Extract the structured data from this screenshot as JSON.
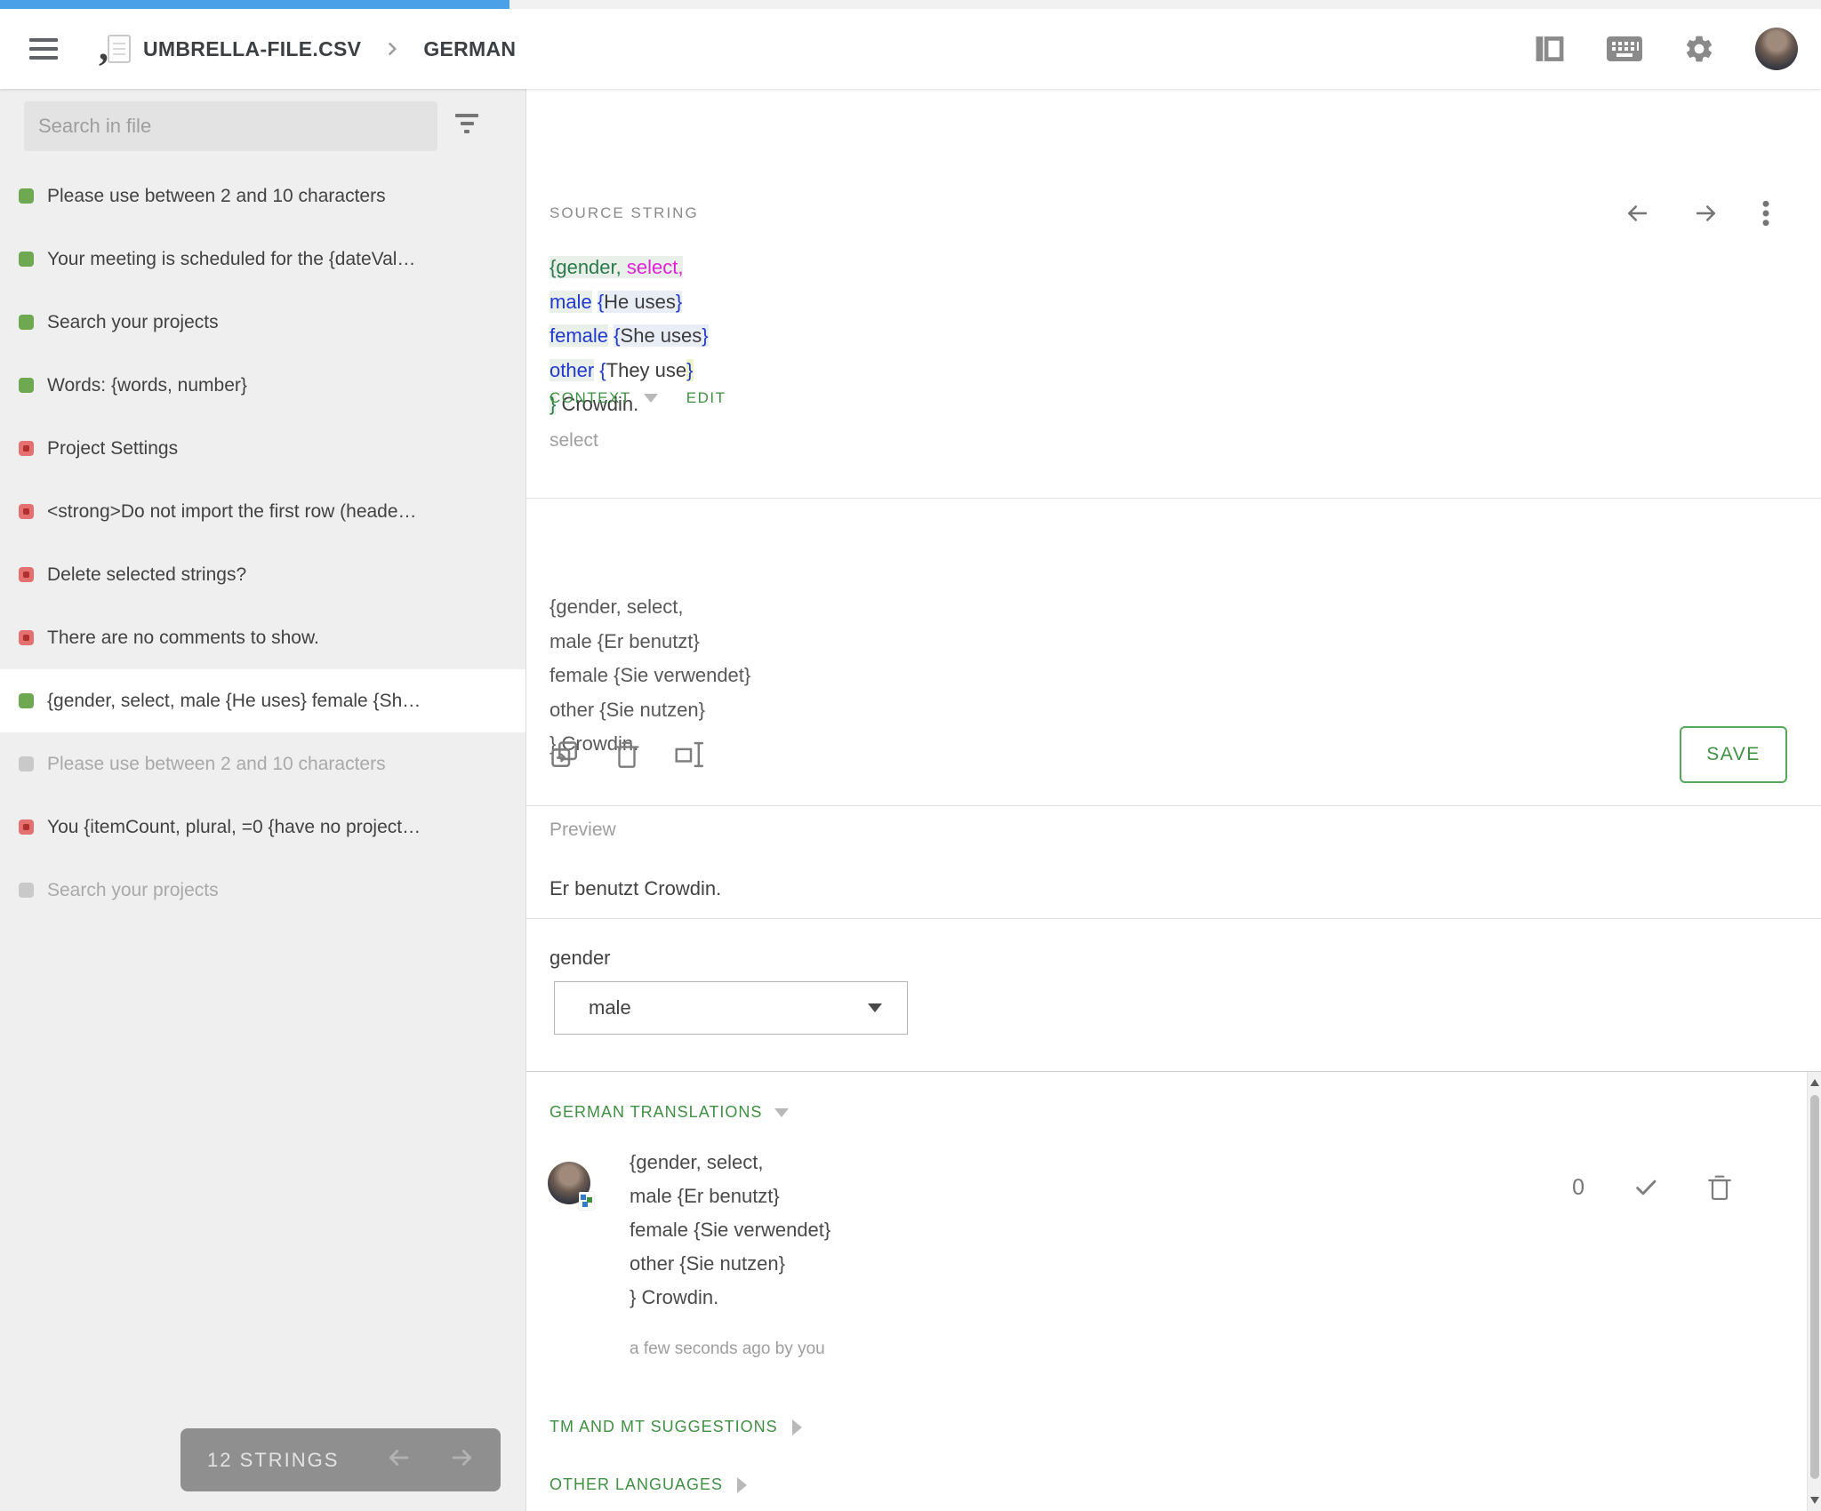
{
  "progress": {
    "value_pct": 28,
    "color": "#4aa1e8"
  },
  "topbar": {
    "file_name": "UMBRELLA-FILE.CSV",
    "language": "GERMAN"
  },
  "sidebar": {
    "search_placeholder": "Search in file",
    "items": [
      {
        "label": "Please use between 2 and 10 characters",
        "status": "green",
        "selected": false
      },
      {
        "label": "Your meeting is scheduled for the {dateVal…",
        "status": "green",
        "selected": false
      },
      {
        "label": "Search your projects",
        "status": "green",
        "selected": false
      },
      {
        "label": "Words: {words, number}",
        "status": "green",
        "selected": false
      },
      {
        "label": "Project Settings",
        "status": "red",
        "selected": false
      },
      {
        "label": "<strong>Do not import the first row (heade…",
        "status": "red",
        "selected": false
      },
      {
        "label": "Delete selected strings?",
        "status": "red",
        "selected": false
      },
      {
        "label": "There are no comments to show.",
        "status": "red",
        "selected": false
      },
      {
        "label": "{gender, select, male {He uses} female {Sh…",
        "status": "green",
        "selected": true
      },
      {
        "label": "Please use between 2 and 10 characters",
        "status": "gray",
        "selected": false
      },
      {
        "label": "You {itemCount, plural, =0 {have no project…",
        "status": "red",
        "selected": false
      },
      {
        "label": "Search your projects",
        "status": "gray",
        "selected": false
      }
    ],
    "footer": {
      "count_label": "12 STRINGS"
    }
  },
  "source": {
    "header": "SOURCE STRING",
    "lines": [
      [
        {
          "t": "{gender, ",
          "c": "c-g bg-g"
        },
        {
          "t": "select,",
          "c": "c-m bg-g"
        }
      ],
      [
        {
          "t": "male",
          "c": "c-b bg-g"
        },
        {
          "t": " ",
          "c": "c-t"
        },
        {
          "t": "{",
          "c": "c-b bg-b"
        },
        {
          "t": "He uses",
          "c": "c-t bg-b"
        },
        {
          "t": "}",
          "c": "c-b bg-b"
        }
      ],
      [
        {
          "t": "female",
          "c": "c-b bg-g"
        },
        {
          "t": " ",
          "c": "c-t"
        },
        {
          "t": "{",
          "c": "c-b bg-b"
        },
        {
          "t": "She uses",
          "c": "c-t bg-b"
        },
        {
          "t": "}",
          "c": "c-b bg-b"
        }
      ],
      [
        {
          "t": "other",
          "c": "c-b bg-g"
        },
        {
          "t": " ",
          "c": "c-t"
        },
        {
          "t": "{",
          "c": "c-b"
        },
        {
          "t": "They use",
          "c": "c-t"
        },
        {
          "t": "}",
          "c": "c-b bg-y"
        }
      ],
      [
        {
          "t": "}",
          "c": "c-g bg-g"
        },
        {
          "t": " Crowdin.",
          "c": "c-t"
        }
      ]
    ],
    "context_label": "CONTEXT",
    "edit_label": "EDIT",
    "context_value": "select"
  },
  "editor": {
    "lines": [
      "{gender, select,",
      "male {Er benutzt}",
      "female {Sie verwendet}",
      "other {Sie nutzen}",
      "} Crowdin."
    ],
    "save_label": "SAVE"
  },
  "preview": {
    "label": "Preview",
    "text": "Er benutzt Crowdin.",
    "param_label": "gender",
    "param_value": "male"
  },
  "translations": {
    "header": "GERMAN TRANSLATIONS",
    "entry": {
      "lines": [
        "{gender, select,",
        "male {Er benutzt}",
        "female {Sie verwendet}",
        "other {Sie nutzen}",
        "} Crowdin."
      ],
      "meta": "a few seconds ago by you",
      "rating": "0"
    },
    "tm_label": "TM AND MT SUGGESTIONS",
    "other_label": "OTHER LANGUAGES"
  }
}
